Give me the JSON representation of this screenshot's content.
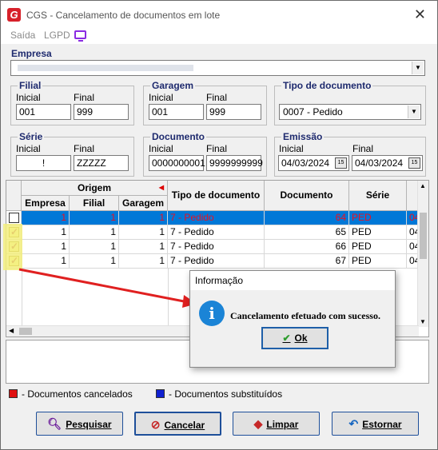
{
  "window": {
    "title": "CGS - Cancelamento de documentos em lote",
    "close": "✕"
  },
  "menu": [
    "Saída",
    "LGPD"
  ],
  "empresa": {
    "label": "Empresa",
    "value": ""
  },
  "filial": {
    "title": "Filial",
    "inicial_label": "Inicial",
    "final_label": "Final",
    "inicial": "001",
    "final": "999"
  },
  "garagem": {
    "title": "Garagem",
    "inicial_label": "Inicial",
    "final_label": "Final",
    "inicial": "001",
    "final": "999"
  },
  "tipo_documento": {
    "title": "Tipo de documento",
    "value": "0007 - Pedido"
  },
  "serie": {
    "title": "Série",
    "inicial_label": "Inicial",
    "final_label": "Final",
    "inicial": "!",
    "final": "ZZZZZ"
  },
  "documento": {
    "title": "Documento",
    "inicial_label": "Inicial",
    "final_label": "Final",
    "inicial": "0000000001",
    "final": "9999999999"
  },
  "emissao": {
    "title": "Emissão",
    "inicial_label": "Inicial",
    "final_label": "Final",
    "inicial": "04/03/2024",
    "final": "04/03/2024",
    "calendar_glyph": "15"
  },
  "grid": {
    "group_header": "Origem",
    "columns": [
      "Empresa",
      "Filial",
      "Garagem",
      "Tipo de documento",
      "Documento",
      "Série"
    ],
    "rows": [
      {
        "checked": false,
        "empresa": "1",
        "filial": "1",
        "garagem": "1",
        "tipo": "7 - Pedido",
        "documento": "64",
        "serie": "PED",
        "extra": "04",
        "selected": true
      },
      {
        "checked": true,
        "empresa": "1",
        "filial": "1",
        "garagem": "1",
        "tipo": "7 - Pedido",
        "documento": "65",
        "serie": "PED",
        "extra": "04",
        "selected": false
      },
      {
        "checked": true,
        "empresa": "1",
        "filial": "1",
        "garagem": "1",
        "tipo": "7 - Pedido",
        "documento": "66",
        "serie": "PED",
        "extra": "04",
        "selected": false
      },
      {
        "checked": true,
        "empresa": "1",
        "filial": "1",
        "garagem": "1",
        "tipo": "7 - Pedido",
        "documento": "67",
        "serie": "PED",
        "extra": "04",
        "selected": false
      }
    ]
  },
  "legend": {
    "cancelados": "- Documentos cancelados",
    "substituidos": "- Documentos substituídos",
    "red": "#e01010",
    "blue": "#1020d0"
  },
  "buttons": {
    "pesquisar": "Pesquisar",
    "cancelar": "Cancelar",
    "limpar": "Limpar",
    "estornar": "Estornar"
  },
  "dialog": {
    "title": "Informação",
    "message": "Cancelamento efetuado com sucesso.",
    "ok": "Ok",
    "icon": "i"
  },
  "colors": {
    "selection": "#0078d7",
    "accent": "#1e2a6e",
    "arrow": "#e02020"
  }
}
